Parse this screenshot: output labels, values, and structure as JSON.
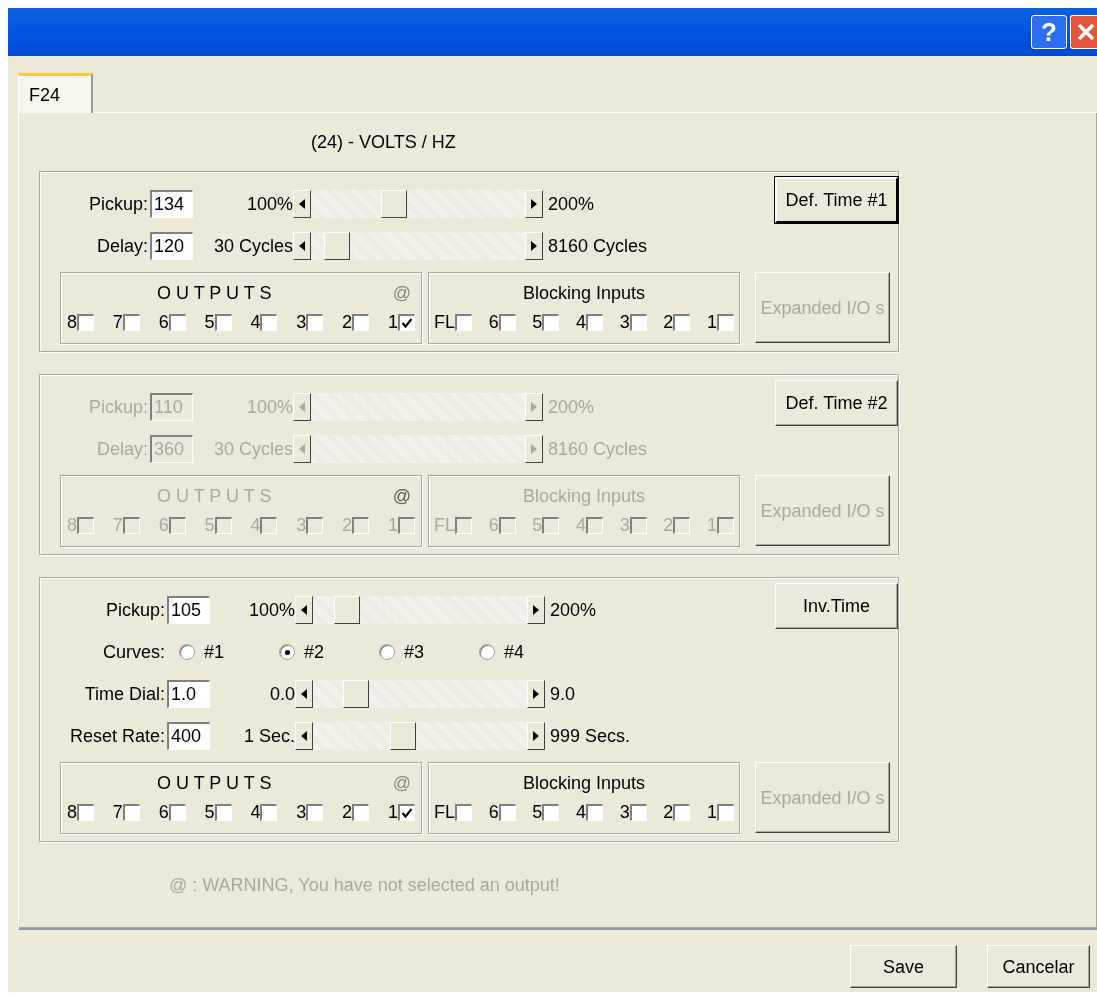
{
  "title_bar": {
    "help": "?"
  },
  "tabs": [
    {
      "label": "F24",
      "selected": true
    }
  ],
  "heading": "(24) - VOLTS / HZ",
  "sections": [
    {
      "disabled": false,
      "button": {
        "label": "Def. Time #1",
        "default": true
      },
      "rows": [
        {
          "kind": "slider",
          "label": "Pickup:",
          "value": "134",
          "min_label": "100%",
          "max_label": "200%",
          "level": 0.37
        },
        {
          "kind": "slider",
          "label": "Delay:",
          "value": "120",
          "min_label": "30 Cycles",
          "max_label": "8160 Cycles",
          "level": 0.07
        }
      ],
      "outputs": {
        "title": "O U T P U T S",
        "warning_mark": "@",
        "warning_active": false,
        "items": [
          {
            "label": "8",
            "checked": false
          },
          {
            "label": "7",
            "checked": false
          },
          {
            "label": "6",
            "checked": false
          },
          {
            "label": "5",
            "checked": false
          },
          {
            "label": "4",
            "checked": false
          },
          {
            "label": "3",
            "checked": false
          },
          {
            "label": "2",
            "checked": false
          },
          {
            "label": "1",
            "checked": true
          }
        ]
      },
      "blocking": {
        "title": "Blocking Inputs",
        "items": [
          {
            "label": "FL",
            "checked": false
          },
          {
            "label": "6",
            "checked": false
          },
          {
            "label": "5",
            "checked": false
          },
          {
            "label": "4",
            "checked": false
          },
          {
            "label": "3",
            "checked": false
          },
          {
            "label": "2",
            "checked": false
          },
          {
            "label": "1",
            "checked": false
          }
        ]
      },
      "expanded": {
        "label": "Expanded I/O s",
        "disabled": true
      }
    },
    {
      "disabled": true,
      "button": {
        "label": "Def. Time #2",
        "default": false
      },
      "rows": [
        {
          "kind": "slider",
          "label": "Pickup:",
          "value": "110",
          "min_label": "100%",
          "max_label": "200%"
        },
        {
          "kind": "slider",
          "label": "Delay:",
          "value": "360",
          "min_label": "30 Cycles",
          "max_label": "8160 Cycles"
        }
      ],
      "outputs": {
        "title": "O U T P U T S",
        "warning_mark": "@",
        "warning_active": true,
        "items": [
          {
            "label": "8",
            "checked": false
          },
          {
            "label": "7",
            "checked": false
          },
          {
            "label": "6",
            "checked": false
          },
          {
            "label": "5",
            "checked": false
          },
          {
            "label": "4",
            "checked": false
          },
          {
            "label": "3",
            "checked": false
          },
          {
            "label": "2",
            "checked": false
          },
          {
            "label": "1",
            "checked": false
          }
        ]
      },
      "blocking": {
        "title": "Blocking Inputs",
        "items": [
          {
            "label": "FL",
            "checked": false
          },
          {
            "label": "6",
            "checked": false
          },
          {
            "label": "5",
            "checked": false
          },
          {
            "label": "4",
            "checked": false
          },
          {
            "label": "3",
            "checked": false
          },
          {
            "label": "2",
            "checked": false
          },
          {
            "label": "1",
            "checked": false
          }
        ]
      },
      "expanded": {
        "label": "Expanded I/O s",
        "disabled": true
      }
    },
    {
      "disabled": false,
      "button": {
        "label": "Inv.Time",
        "default": false
      },
      "rows": [
        {
          "kind": "slider",
          "label": "Pickup:",
          "value": "105",
          "min_label": "100%",
          "max_label": "200%",
          "level": 0.11
        },
        {
          "kind": "radio",
          "label": "Curves:",
          "options": [
            {
              "label": "#1",
              "selected": false
            },
            {
              "label": "#2",
              "selected": true
            },
            {
              "label": "#3",
              "selected": false
            },
            {
              "label": "#4",
              "selected": false
            }
          ]
        },
        {
          "kind": "slider",
          "label": "Time Dial:",
          "value": "1.0",
          "min_label": "0.0",
          "max_label": "9.0",
          "level": 0.16
        },
        {
          "kind": "slider",
          "label": "Reset Rate:",
          "value": "400",
          "min_label": "1 Sec.",
          "max_label": "999 Secs.",
          "level": 0.41
        }
      ],
      "outputs": {
        "title": "O U T P U T S",
        "warning_mark": "@",
        "warning_active": false,
        "items": [
          {
            "label": "8",
            "checked": false
          },
          {
            "label": "7",
            "checked": false
          },
          {
            "label": "6",
            "checked": false
          },
          {
            "label": "5",
            "checked": false
          },
          {
            "label": "4",
            "checked": false
          },
          {
            "label": "3",
            "checked": false
          },
          {
            "label": "2",
            "checked": false
          },
          {
            "label": "1",
            "checked": true
          }
        ]
      },
      "blocking": {
        "title": "Blocking Inputs",
        "items": [
          {
            "label": "FL",
            "checked": false
          },
          {
            "label": "6",
            "checked": false
          },
          {
            "label": "5",
            "checked": false
          },
          {
            "label": "4",
            "checked": false
          },
          {
            "label": "3",
            "checked": false
          },
          {
            "label": "2",
            "checked": false
          },
          {
            "label": "1",
            "checked": false
          }
        ]
      },
      "expanded": {
        "label": "Expanded I/O s",
        "disabled": true
      }
    }
  ],
  "warning": {
    "text": "@ : WARNING, You have not selected an output!",
    "active": false
  },
  "buttons": [
    "Save",
    "Cancelar"
  ]
}
